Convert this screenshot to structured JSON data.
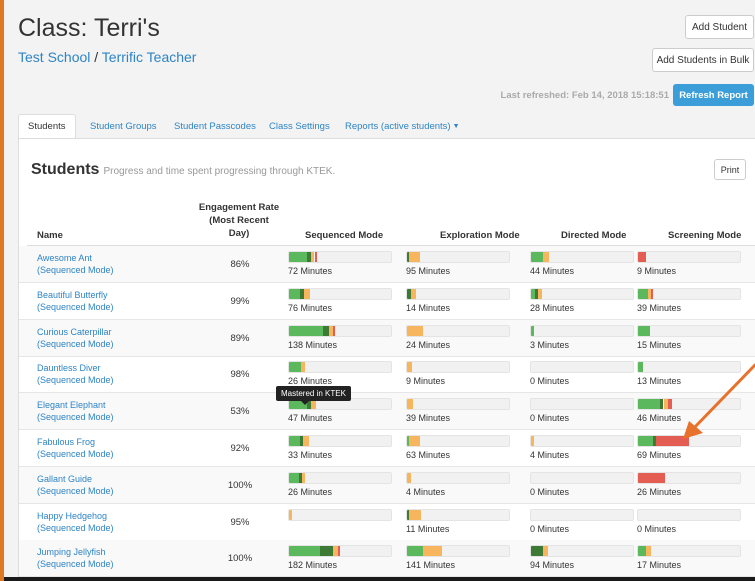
{
  "header": {
    "title": "Class: Terri's",
    "school": "Test School",
    "separator": " / ",
    "teacher": "Terrific Teacher",
    "add_student": "Add Student",
    "add_bulk": "Add Students in Bulk",
    "last_refreshed": "Last refreshed: Feb 14, 2018 15:18:51",
    "refresh": "Refresh Report"
  },
  "tabs": [
    "Students",
    "Student Groups",
    "Student Passcodes",
    "Class Settings",
    "Reports (active students)"
  ],
  "panel": {
    "title": "Students",
    "subtitle": "Progress and time spent progressing through KTEK.",
    "print": "Print"
  },
  "columns": {
    "name": "Name",
    "engagement_1": "Engagement Rate",
    "engagement_2": "(Most Recent",
    "engagement_3": "Day)",
    "sequenced": "Sequenced Mode",
    "exploration": "Exploration Mode",
    "directed": "Directed Mode",
    "screening": "Screening Mode"
  },
  "colors": {
    "green": "#5cb85c",
    "dark_green": "#3d7a35",
    "orange": "#f7b55e",
    "red": "#e45d52",
    "link": "#2e84c6",
    "accent": "#3b9ed8"
  },
  "tooltip": "Mastered in KTEK",
  "students": [
    {
      "name": "Awesome Ant",
      "mode": "(Sequenced Mode)",
      "engagement": "86%",
      "modes": {
        "sequenced": {
          "minutes": "72 Minutes",
          "bar": [
            [
              "green",
              0.18
            ],
            [
              "dark_green",
              0.04
            ],
            [
              "orange",
              0.03
            ],
            [
              "red",
              0.02
            ]
          ]
        },
        "exploration": {
          "minutes": "95 Minutes",
          "bar": [
            [
              "dark_green",
              0.02
            ],
            [
              "orange",
              0.11
            ]
          ]
        },
        "directed": {
          "minutes": "44 Minutes",
          "bar": [
            [
              "green",
              0.12
            ],
            [
              "orange",
              0.06
            ]
          ]
        },
        "screening": {
          "minutes": "9 Minutes",
          "bar": [
            [
              "red",
              0.08
            ]
          ]
        }
      }
    },
    {
      "name": "Beautiful Butterfly",
      "mode": "(Sequenced Mode)",
      "engagement": "99%",
      "modes": {
        "sequenced": {
          "minutes": "76 Minutes",
          "bar": [
            [
              "green",
              0.11
            ],
            [
              "dark_green",
              0.04
            ],
            [
              "orange",
              0.06
            ]
          ]
        },
        "exploration": {
          "minutes": "14 Minutes",
          "bar": [
            [
              "dark_green",
              0.04
            ],
            [
              "orange",
              0.05
            ]
          ]
        },
        "directed": {
          "minutes": "28 Minutes",
          "bar": [
            [
              "green",
              0.04
            ],
            [
              "dark_green",
              0.03
            ],
            [
              "orange",
              0.04
            ]
          ]
        },
        "screening": {
          "minutes": "39 Minutes",
          "bar": [
            [
              "green",
              0.1
            ],
            [
              "orange",
              0.03
            ],
            [
              "red",
              0.02
            ]
          ]
        }
      }
    },
    {
      "name": "Curious Caterpillar",
      "mode": "(Sequenced Mode)",
      "engagement": "89%",
      "modes": {
        "sequenced": {
          "minutes": "138 Minutes",
          "bar": [
            [
              "green",
              0.33
            ],
            [
              "dark_green",
              0.06
            ],
            [
              "orange",
              0.04
            ],
            [
              "red",
              0.02
            ]
          ]
        },
        "exploration": {
          "minutes": "24 Minutes",
          "bar": [
            [
              "orange",
              0.16
            ]
          ]
        },
        "directed": {
          "minutes": "3 Minutes",
          "bar": [
            [
              "green",
              0.03
            ]
          ]
        },
        "screening": {
          "minutes": "15 Minutes",
          "bar": [
            [
              "green",
              0.12
            ]
          ]
        }
      }
    },
    {
      "name": "Dauntless Diver",
      "mode": "(Sequenced Mode)",
      "engagement": "98%",
      "modes": {
        "sequenced": {
          "minutes": "26 Minutes",
          "bar": [
            [
              "green",
              0.12
            ],
            [
              "orange",
              0.04
            ]
          ]
        },
        "exploration": {
          "minutes": "9 Minutes",
          "bar": [
            [
              "orange",
              0.05
            ]
          ]
        },
        "directed": {
          "minutes": "0 Minutes",
          "bar": []
        },
        "screening": {
          "minutes": "13 Minutes",
          "bar": [
            [
              "green",
              0.05
            ]
          ]
        }
      }
    },
    {
      "name": "Elegant Elephant",
      "mode": "(Sequenced Mode)",
      "engagement": "53%",
      "modes": {
        "sequenced": {
          "minutes": "47 Minutes",
          "bar": [
            [
              "green",
              0.18
            ],
            [
              "dark_green",
              0.04
            ],
            [
              "orange",
              0.04
            ]
          ]
        },
        "exploration": {
          "minutes": "39 Minutes",
          "bar": [
            [
              "orange",
              0.06
            ]
          ]
        },
        "directed": {
          "minutes": "0 Minutes",
          "bar": []
        },
        "screening": {
          "minutes": "46 Minutes",
          "bar": [
            [
              "green",
              0.22
            ],
            [
              "dark_green",
              0.03
            ],
            [
              "orange",
              0.04
            ],
            [
              "red",
              0.04
            ]
          ]
        }
      }
    },
    {
      "name": "Fabulous Frog",
      "mode": "(Sequenced Mode)",
      "engagement": "92%",
      "modes": {
        "sequenced": {
          "minutes": "33 Minutes",
          "bar": [
            [
              "green",
              0.11
            ],
            [
              "dark_green",
              0.03
            ],
            [
              "orange",
              0.06
            ]
          ]
        },
        "exploration": {
          "minutes": "63 Minutes",
          "bar": [
            [
              "green",
              0.02
            ],
            [
              "orange",
              0.11
            ]
          ]
        },
        "directed": {
          "minutes": "4 Minutes",
          "bar": [
            [
              "orange",
              0.03
            ]
          ]
        },
        "screening": {
          "minutes": "69 Minutes",
          "bar": [
            [
              "green",
              0.15
            ],
            [
              "dark_green",
              0.03
            ],
            [
              "red",
              0.32
            ]
          ]
        }
      }
    },
    {
      "name": "Gallant Guide",
      "mode": "(Sequenced Mode)",
      "engagement": "100%",
      "modes": {
        "sequenced": {
          "minutes": "26 Minutes",
          "bar": [
            [
              "green",
              0.1
            ],
            [
              "dark_green",
              0.03
            ],
            [
              "orange",
              0.03
            ]
          ]
        },
        "exploration": {
          "minutes": "4 Minutes",
          "bar": [
            [
              "orange",
              0.04
            ]
          ]
        },
        "directed": {
          "minutes": "0 Minutes",
          "bar": []
        },
        "screening": {
          "minutes": "26 Minutes",
          "bar": [
            [
              "red",
              0.26
            ]
          ]
        }
      }
    },
    {
      "name": "Happy Hedgehog",
      "mode": "(Sequenced Mode)",
      "engagement": "95%",
      "modes": {
        "sequenced": {
          "minutes": "",
          "bar": [
            [
              "orange",
              0.03
            ]
          ]
        },
        "exploration": {
          "minutes": "11 Minutes",
          "bar": [
            [
              "dark_green",
              0.02
            ],
            [
              "orange",
              0.12
            ]
          ]
        },
        "directed": {
          "minutes": "0 Minutes",
          "bar": []
        },
        "screening": {
          "minutes": "0 Minutes",
          "bar": []
        }
      }
    },
    {
      "name": "Jumping Jellyfish",
      "mode": "(Sequenced Mode)",
      "engagement": "100%",
      "modes": {
        "sequenced": {
          "minutes": "182 Minutes",
          "bar": [
            [
              "green",
              0.3
            ],
            [
              "dark_green",
              0.13
            ],
            [
              "orange",
              0.05
            ],
            [
              "red",
              0.02
            ]
          ]
        },
        "exploration": {
          "minutes": "141 Minutes",
          "bar": [
            [
              "green",
              0.16
            ],
            [
              "orange",
              0.18
            ]
          ]
        },
        "directed": {
          "minutes": "94 Minutes",
          "bar": [
            [
              "dark_green",
              0.12
            ],
            [
              "orange",
              0.05
            ]
          ]
        },
        "screening": {
          "minutes": "17 Minutes",
          "bar": [
            [
              "green",
              0.08
            ],
            [
              "orange",
              0.05
            ]
          ]
        }
      }
    }
  ]
}
